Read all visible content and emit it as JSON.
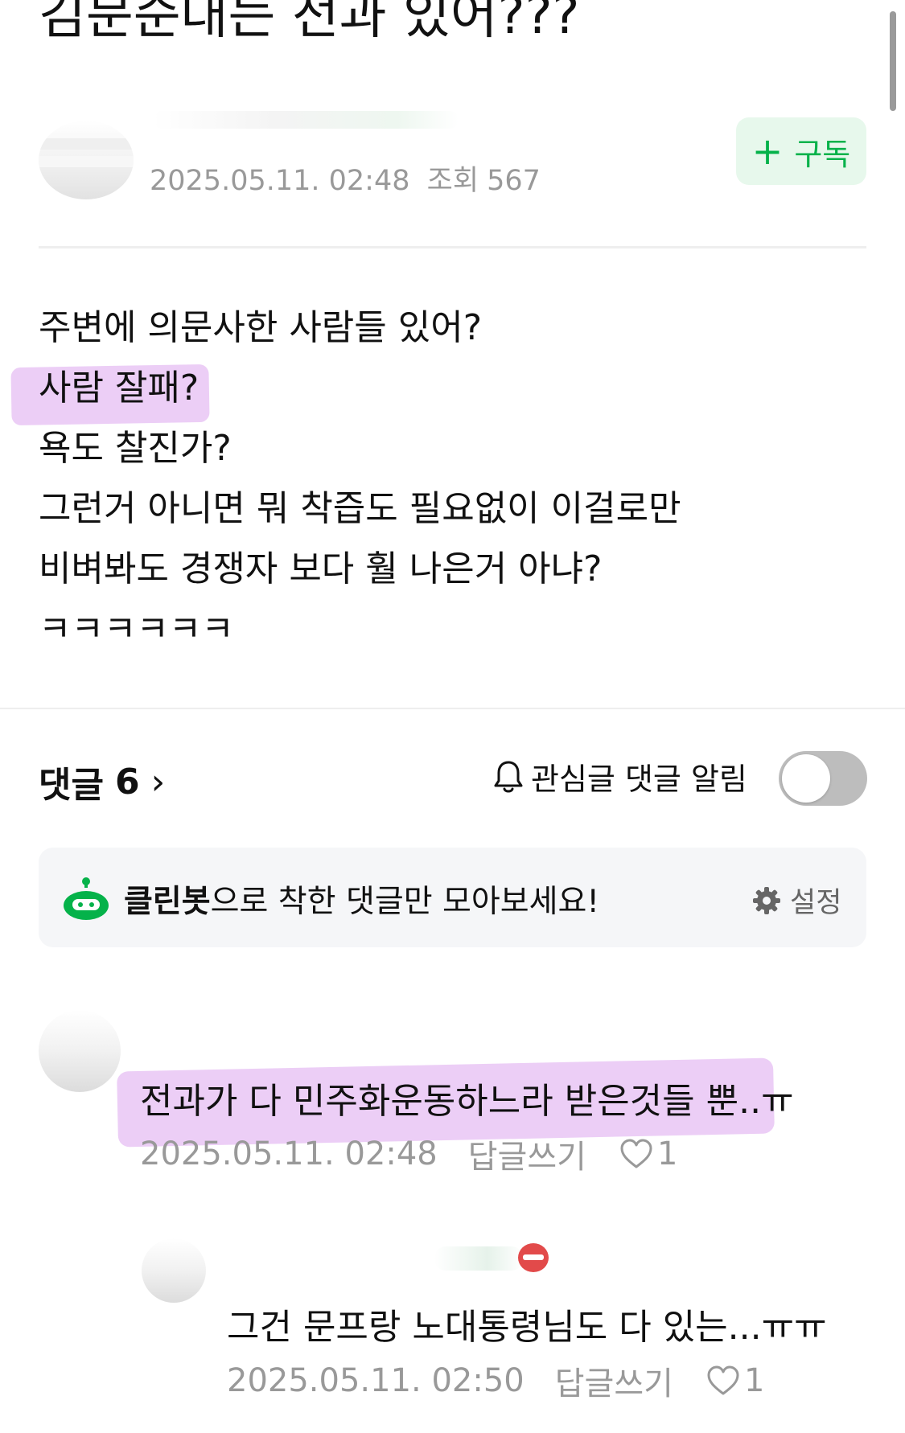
{
  "post": {
    "title": "김문순대는 전과 있어???",
    "date": "2025.05.11. 02:48",
    "views_label": "조회",
    "views": "567",
    "subscribe_label": "구독",
    "body_lines": [
      "주변에 의문사한 사람들 있어?",
      "사람 잘패?",
      "욕도 찰진가?",
      "그런거 아니면 뭐 착즙도 필요없이 이걸로만",
      "비벼봐도 경쟁자 보다 훨 나은거 아냐?",
      "ㅋㅋㅋㅋㅋㅋ"
    ]
  },
  "comments_section": {
    "label": "댓글",
    "count": "6",
    "notify_label": "관심글 댓글 알림",
    "notify_on": false,
    "cleanbot_name": "클린봇",
    "cleanbot_message": "으로 착한 댓글만 모아보세요!",
    "settings_label": "설정"
  },
  "comments": [
    {
      "text": "전과가 다 민주화운동하느라 받은것들 뿐..ㅠ",
      "date": "2025.05.11. 02:48",
      "reply_label": "답글쓰기",
      "likes": "1"
    },
    {
      "text": "그건 문프랑 노대통령님도 다 있는...ㅠㅠ",
      "date": "2025.05.11. 02:50",
      "reply_label": "답글쓰기",
      "likes": "1"
    }
  ],
  "colors": {
    "accent_green": "#05b24a",
    "highlight": "#e9c6f5",
    "meta_gray": "#999999"
  }
}
